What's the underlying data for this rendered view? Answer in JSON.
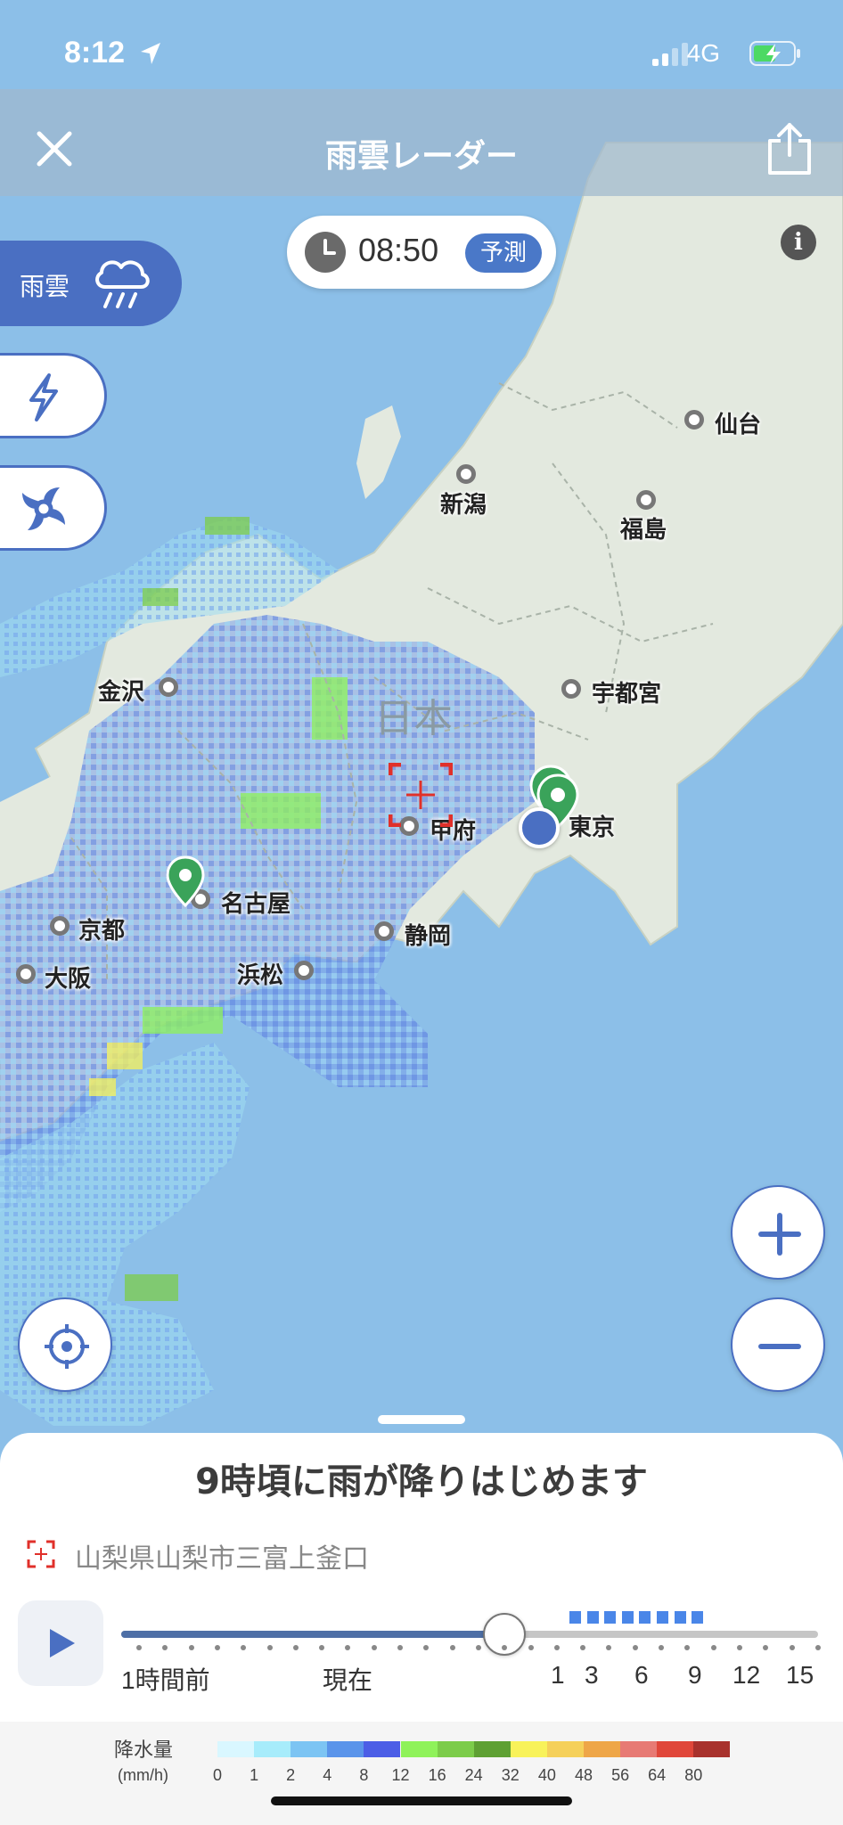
{
  "status_bar": {
    "time": "8:12",
    "network": "4G"
  },
  "header": {
    "title": "雨雲レーダー"
  },
  "time_pill": {
    "time": "08:50",
    "badge": "予測"
  },
  "layers": {
    "rain_label": "雨雲"
  },
  "map": {
    "country": "日本",
    "cities": [
      {
        "name": "仙台"
      },
      {
        "name": "新潟"
      },
      {
        "name": "福島"
      },
      {
        "name": "宇都宮"
      },
      {
        "name": "金沢"
      },
      {
        "name": "東京"
      },
      {
        "name": "甲府"
      },
      {
        "name": "名古屋"
      },
      {
        "name": "京都"
      },
      {
        "name": "静岡"
      },
      {
        "name": "大阪"
      },
      {
        "name": "浜松"
      }
    ]
  },
  "sheet": {
    "headline": "9時頃に雨が降りはじめます",
    "location": "山梨県山梨市三富上釜口",
    "timeline_position": 0.55,
    "labels": [
      "1時間前",
      "現在",
      "1",
      "3",
      "6",
      "9",
      "12",
      "15"
    ]
  },
  "legend": {
    "title": "降水量",
    "unit": "(mm/h)",
    "values": [
      "0",
      "1",
      "2",
      "4",
      "8",
      "12",
      "16",
      "24",
      "32",
      "40",
      "48",
      "56",
      "64",
      "80"
    ],
    "colors": [
      "#d9f7ff",
      "#a7ecfb",
      "#7cc4f3",
      "#5a94ea",
      "#4c5ee6",
      "#8ff25a",
      "#7ccc4a",
      "#5ea033",
      "#f8f25a",
      "#f5d05a",
      "#eea648",
      "#e77a74",
      "#e0473a",
      "#a8322d"
    ]
  }
}
